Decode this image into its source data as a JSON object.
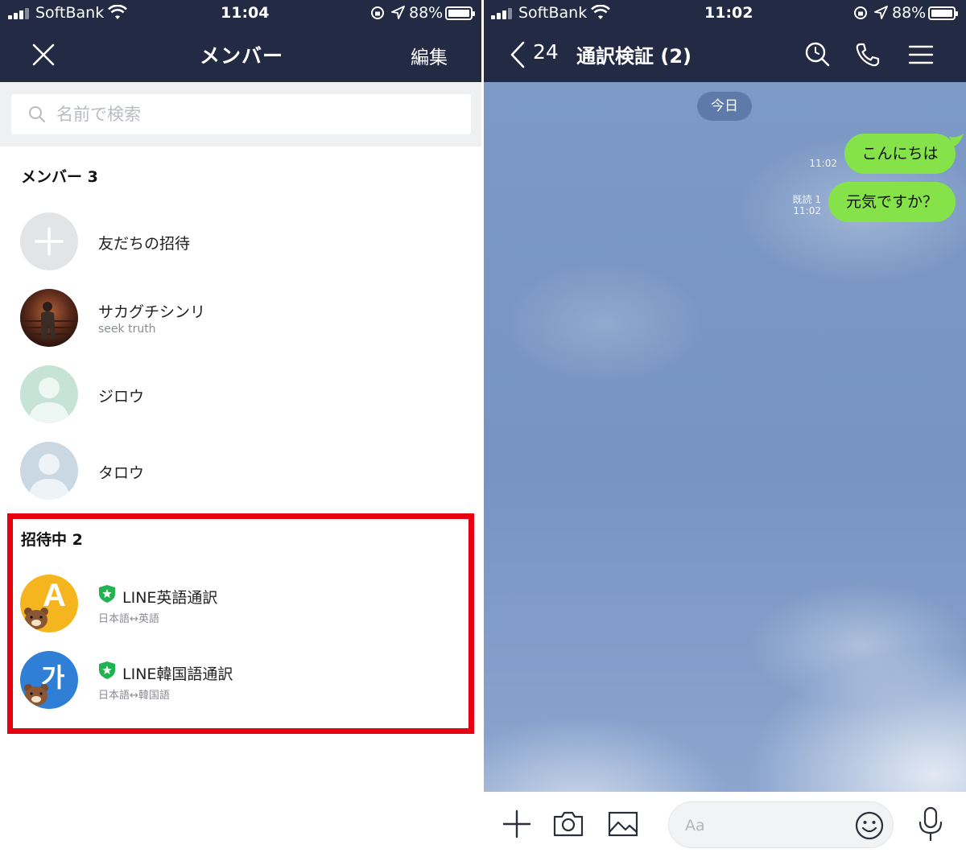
{
  "left": {
    "status": {
      "carrier": "SoftBank",
      "time": "11:04",
      "battery": "88%",
      "battery_level": 0.88
    },
    "header": {
      "title": "メンバー",
      "edit_label": "編集"
    },
    "search": {
      "placeholder": "名前で検索",
      "value": ""
    },
    "members_section": {
      "title": "メンバー 3",
      "invite_label": "友だちの招待",
      "members": [
        {
          "name": "サカグチシンリ",
          "status": "seek truth"
        },
        {
          "name": "ジロウ"
        },
        {
          "name": "タロウ"
        }
      ]
    },
    "pending_section": {
      "title": "招待中 2",
      "bots": [
        {
          "name": "LINE英語通訳",
          "desc": "日本語↔英語",
          "avatar_text": "A",
          "avatar_color": "#f5b51f"
        },
        {
          "name": "LINE韓国語通訳",
          "desc": "日本語↔韓国語",
          "avatar_text": "가",
          "avatar_color": "#2f7fd6"
        }
      ]
    },
    "colors": {
      "header": "#232a44",
      "highlight": "#e50012",
      "official_badge": "#21b351"
    }
  },
  "right": {
    "status": {
      "carrier": "SoftBank",
      "time": "11:02",
      "battery": "88%",
      "battery_level": 0.88
    },
    "header": {
      "back_count": "24",
      "chat_title": "通訳検証 (2)"
    },
    "date_label": "今日",
    "messages": [
      {
        "text": "こんにちは",
        "time": "11:02",
        "read": ""
      },
      {
        "text": "元気ですか？",
        "time": "11:02",
        "read": "既読 1"
      }
    ],
    "input": {
      "placeholder": "Aa",
      "value": ""
    },
    "colors": {
      "bubble": "#85e249"
    }
  }
}
